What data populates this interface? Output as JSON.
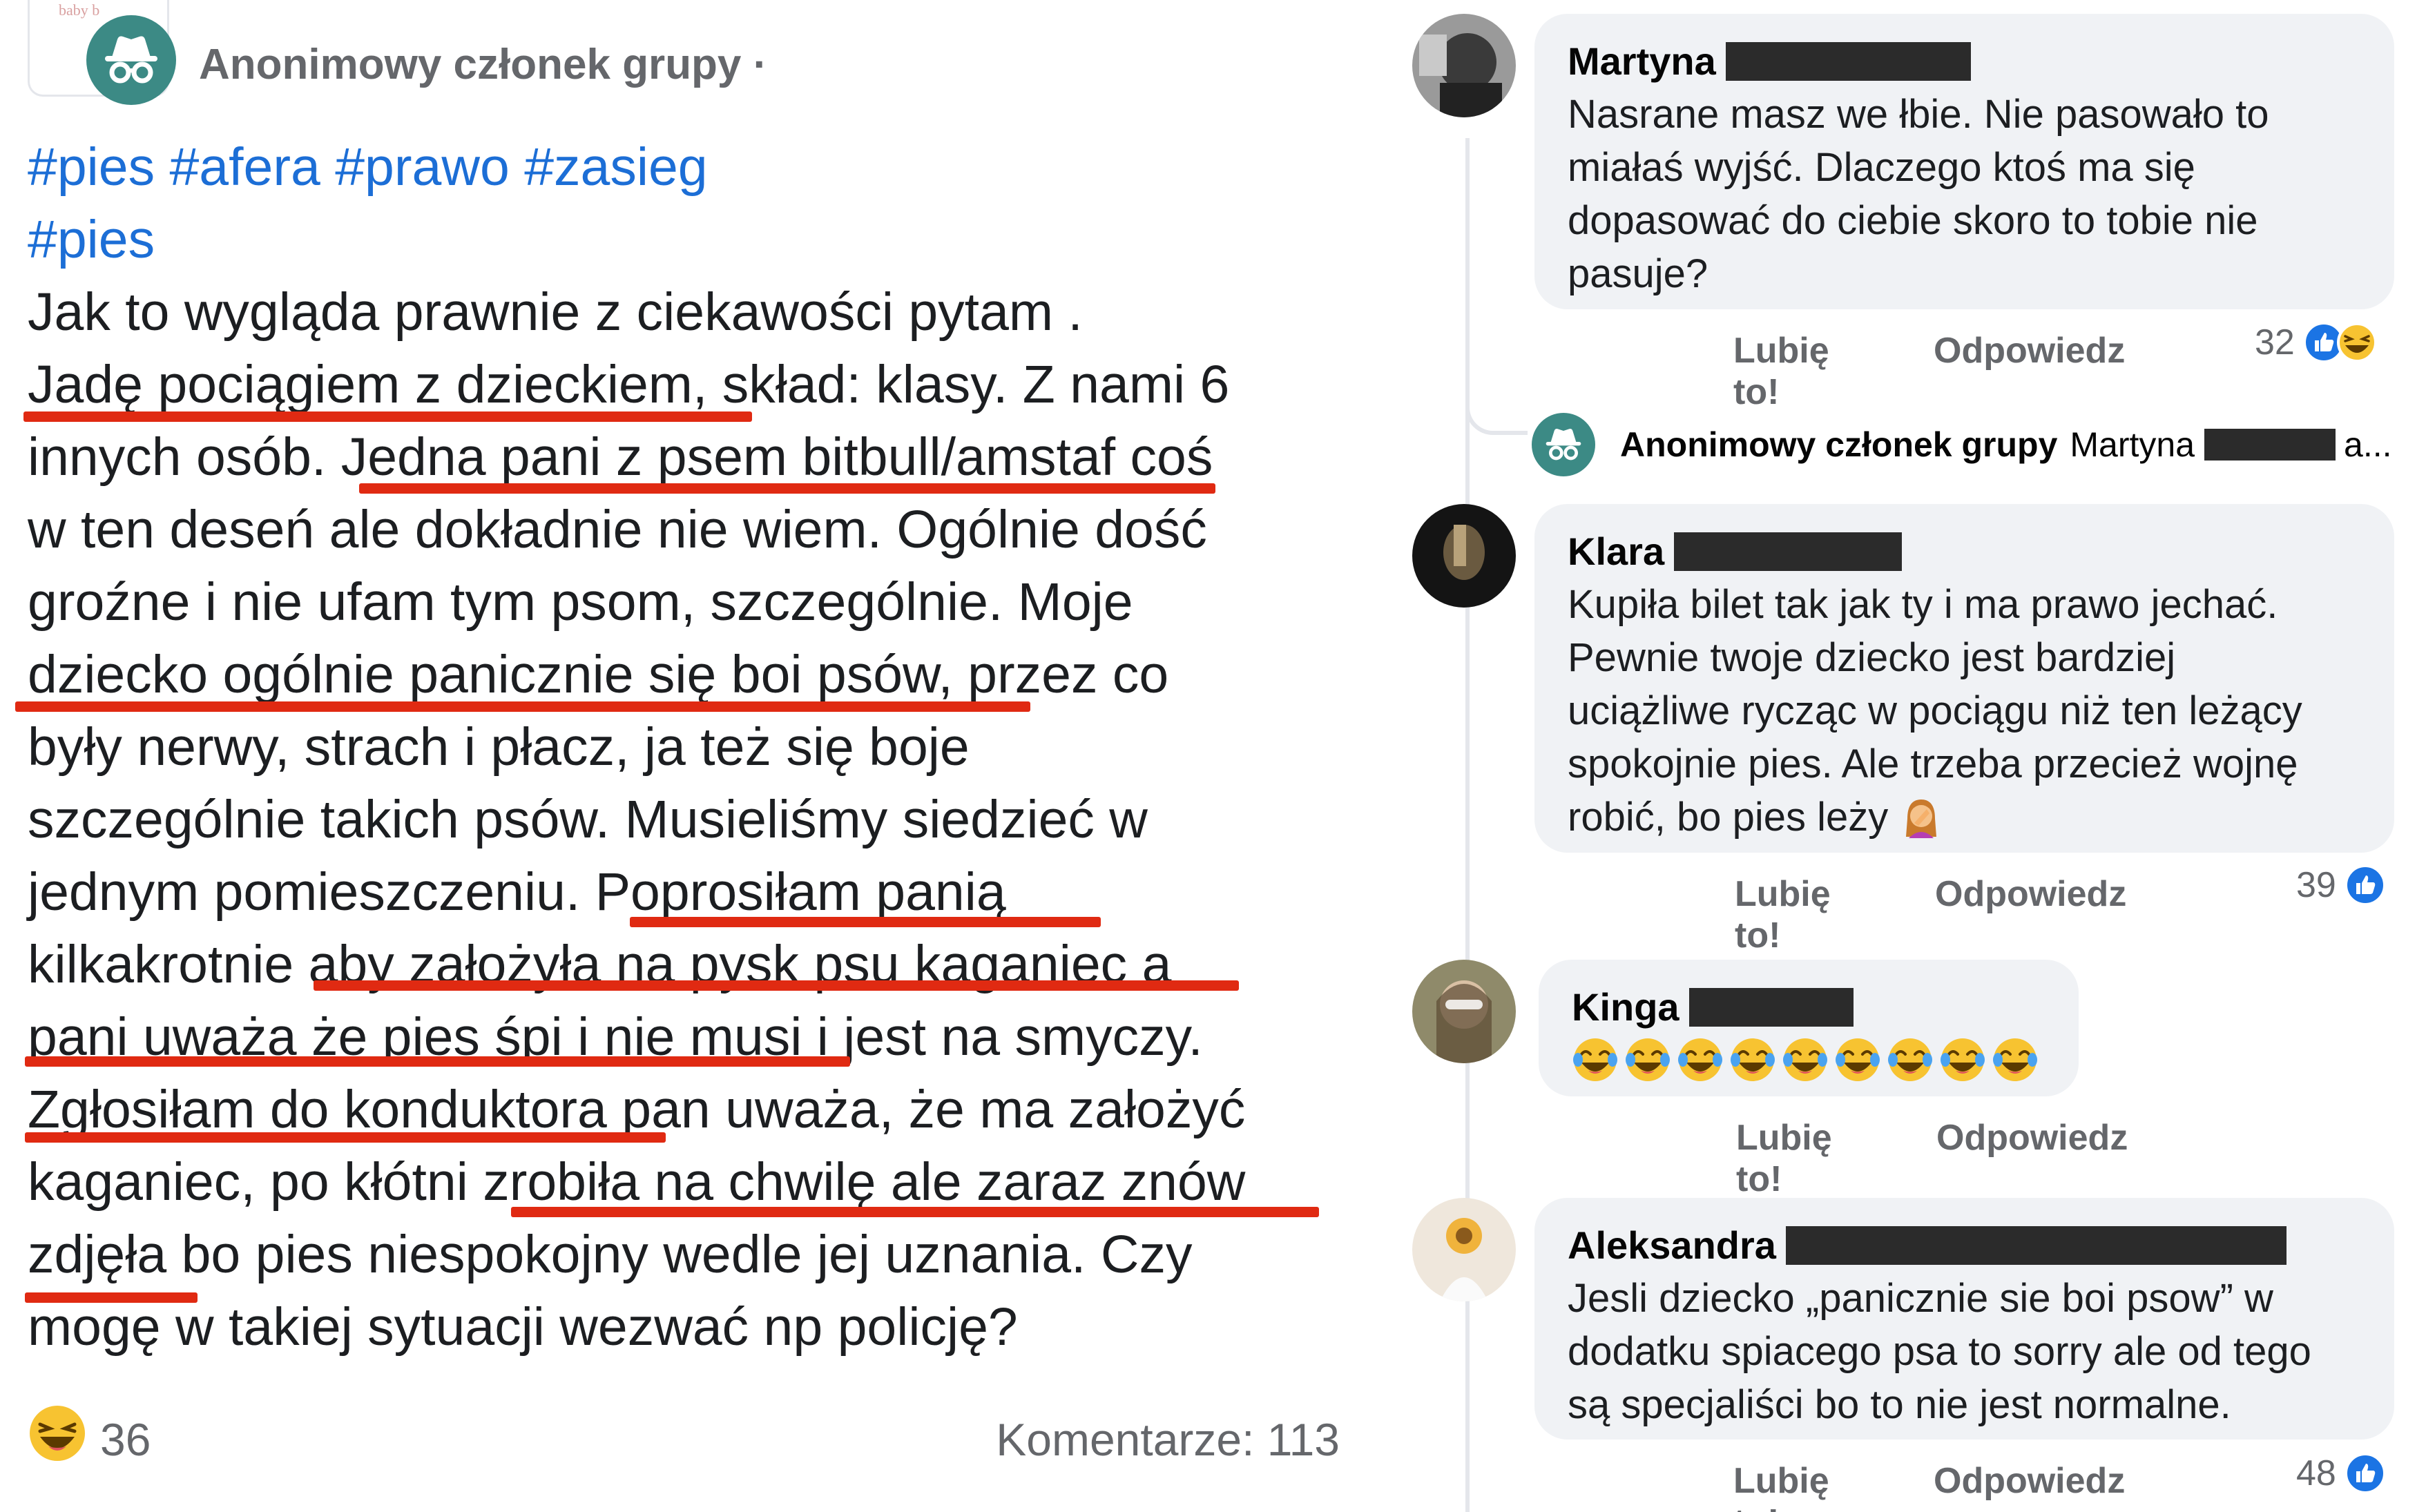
{
  "post": {
    "group_thumb_text": "baby b",
    "author": "Anonimowy członek grupy",
    "author_suffix": "·",
    "hashtags_line1": [
      "#pies",
      "#afera",
      "#prawo",
      "#zasieg"
    ],
    "hashtags_line2": "#pies",
    "lines": [
      "Jak to wygląda prawnie z ciekawości pytam .",
      "Jadę pociągiem z dzieckiem, skład: klasy. Z nami 6",
      "innych osób. Jedna pani z psem bitbull/amstaf coś",
      "w ten deseń ale dokładnie nie wiem. Ogólnie dość",
      "groźne i nie ufam tym psom, szczególnie. Moje",
      "dziecko ogólnie panicznie się boi psów, przez co",
      "były nerwy, strach i płacz, ja też się boje",
      "szczególnie takich psów. Musieliśmy siedzieć w",
      "jednym pomieszczeniu. Poprosiłam panią",
      "kilkakrotnie aby założyła na pysk psu kaganiec a",
      "pani uważa że pies śpi i nie musi i jest na smyczy.",
      "Zgłosiłam do konduktora pan uważa, że ma założyć",
      "kaganiec, po kłótni zrobiła na chwilę ale zaraz znów",
      "zdjęła bo pies niespokojny wedle jej uznania. Czy",
      "mogę w takiej sytuacji wezwać np policję?"
    ],
    "reaction_count": "36",
    "comments_label": "Komentarze: 113",
    "highlight_color": "#e02a12",
    "hashtag_color": "#1c6ed6"
  },
  "comments": [
    {
      "name": "Martyna",
      "lines": [
        "Nasrane masz we łbie. Nie pasowało to",
        "miałaś wyjść. Dlaczego ktoś ma się",
        "dopasować do ciebie skoro to tobie nie",
        "pasuje?"
      ],
      "like_label": "Lubię to!",
      "reply_label": "Odpowiedz",
      "reaction_count": "32"
    },
    {
      "name": "Klara",
      "lines": [
        "Kupiła bilet tak jak ty i ma prawo jechać.",
        "Pewnie twoje dziecko jest bardziej",
        "uciążliwe rycząc w pociągu niż ten leżący",
        "spokojnie pies. Ale trzeba przecież wojnę",
        "robić, bo pies leży"
      ],
      "like_label": "Lubię to!",
      "reply_label": "Odpowiedz",
      "reaction_count": "39"
    },
    {
      "name": "Kinga",
      "emoji_count": 9,
      "like_label": "Lubię to!",
      "reply_label": "Odpowiedz"
    },
    {
      "name": "Aleksandra",
      "lines": [
        "Jesli dziecko „panicznie sie boi psow” w",
        "dodatku spiacego psa to sorry ale od tego",
        "są specjaliści bo to nie jest normalne."
      ],
      "like_label": "Lubię to!",
      "reply_label": "Odpowiedz",
      "reaction_count": "48"
    }
  ],
  "reply_preview": {
    "author": "Anonimowy członek grupy",
    "target": "Martyna",
    "more": "a..."
  }
}
